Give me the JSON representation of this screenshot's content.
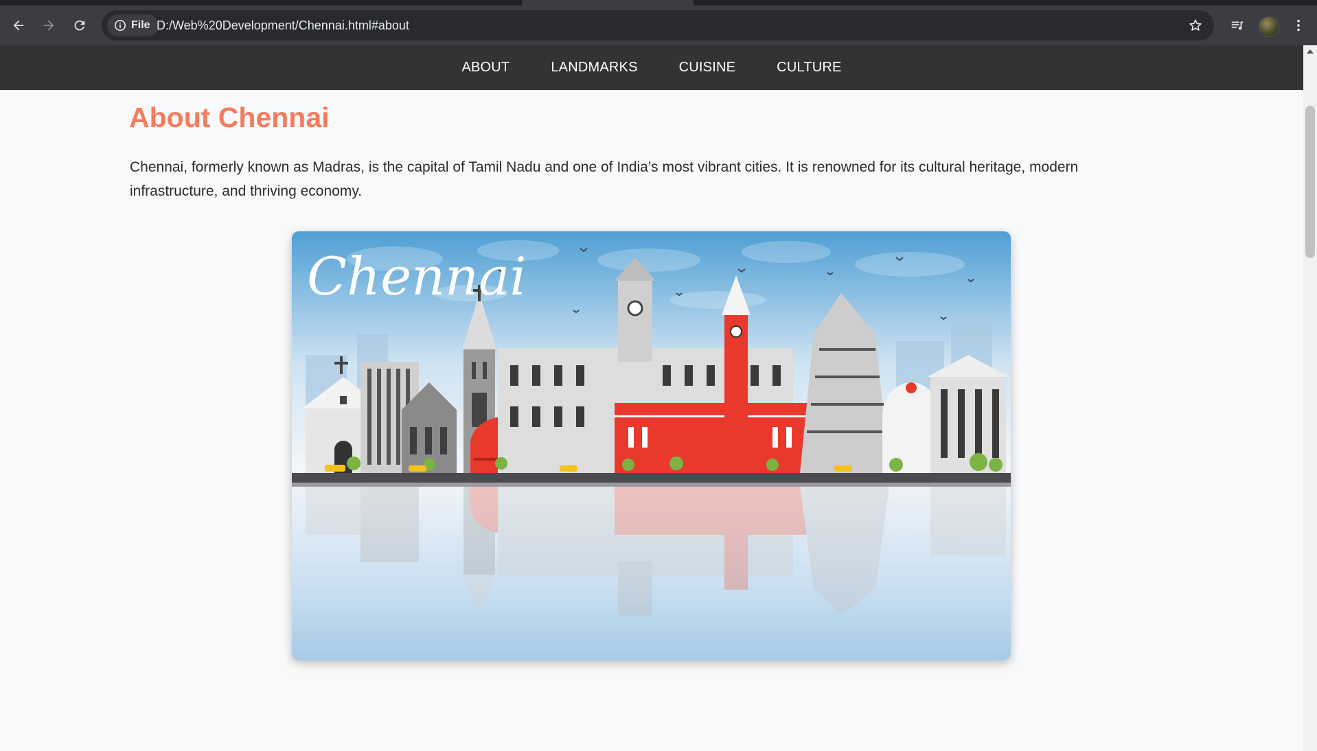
{
  "browser": {
    "site_chip_label": "File",
    "url": "D:/Web%20Development/Chennai.html#about"
  },
  "nav": {
    "items": [
      "ABOUT",
      "LANDMARKS",
      "CUISINE",
      "CULTURE"
    ]
  },
  "about": {
    "heading": "About Chennai",
    "paragraph": "Chennai, formerly known as Madras, is the capital of Tamil Nadu and one of India’s most vibrant cities. It is renowned for its cultural heritage, modern infrastructure, and thriving economy.",
    "image_logo_text": "Chennai"
  },
  "colors": {
    "heading": "#f47c5e",
    "nav_bg": "#333333",
    "landmark_red": "#e8392c",
    "sky": "#5ea7d8"
  },
  "icons": [
    "back-icon",
    "forward-icon",
    "reload-icon",
    "info-icon",
    "star-icon",
    "media-icon",
    "menu-icon"
  ]
}
